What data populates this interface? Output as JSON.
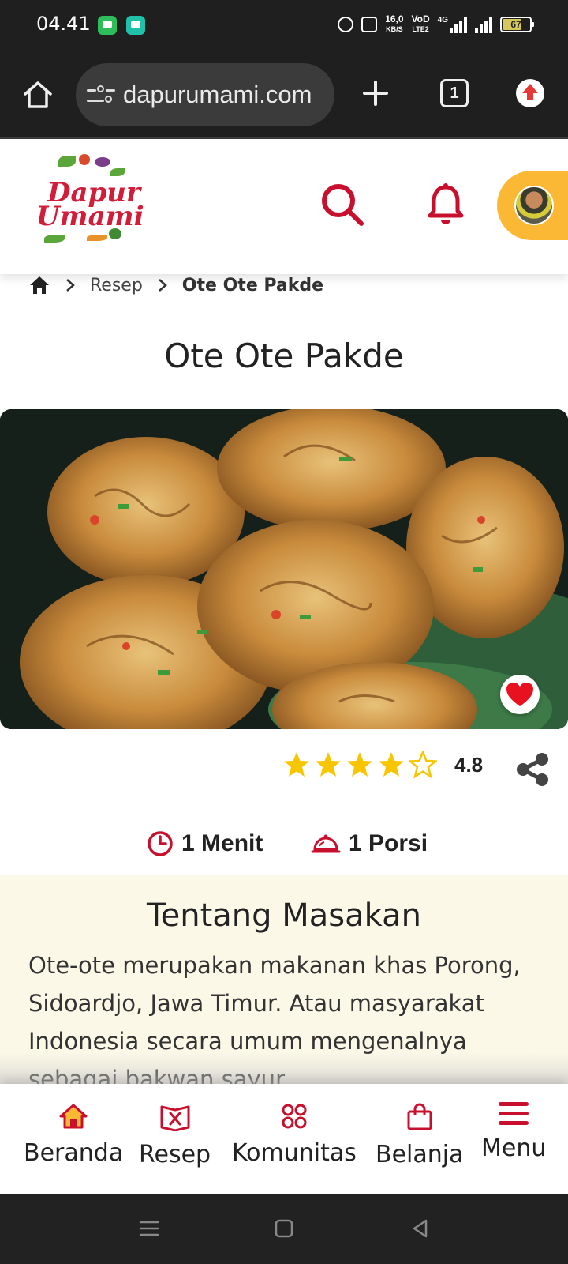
{
  "status_bar": {
    "time": "04.41",
    "net_speed_value": "16,0",
    "net_speed_unit": "KB/S",
    "vowifi_top": "VoD",
    "vowifi_bottom": "LTE2",
    "network_type": "4G",
    "battery": "67"
  },
  "browser": {
    "url": "dapurumami.com",
    "tab_count": "1"
  },
  "site": {
    "logo_line1": "Dapur",
    "logo_line2": "Umami",
    "brand_color": "#c8102e",
    "accent_color": "#fbb834"
  },
  "breadcrumb": {
    "section": "Resep",
    "current": "Ote Ote Pakde"
  },
  "recipe": {
    "title": "Ote Ote Pakde",
    "rating": "4.8",
    "rating_stars": 4,
    "time": "1 Menit",
    "portion": "1 Porsi"
  },
  "about": {
    "heading": "Tentang Masakan",
    "text": "Ote-ote merupakan makanan khas Porong, Sidoardjo, Jawa Timur. Atau masyarakat Indonesia secara umum mengenalnya sebagai bakwan sayur."
  },
  "bottom_nav": {
    "home": "Beranda",
    "recipe": "Resep",
    "community": "Komunitas",
    "shop": "Belanja",
    "menu": "Menu"
  },
  "icons": [
    "home-icon",
    "site-settings-icon",
    "new-tab-icon",
    "tabs-icon",
    "update-icon",
    "search-icon",
    "bell-icon",
    "avatar",
    "heart-icon",
    "star-icon",
    "share-icon",
    "clock-icon",
    "cloche-icon",
    "recipe-book-icon",
    "community-icon",
    "shopping-bag-icon",
    "menu-icon"
  ]
}
